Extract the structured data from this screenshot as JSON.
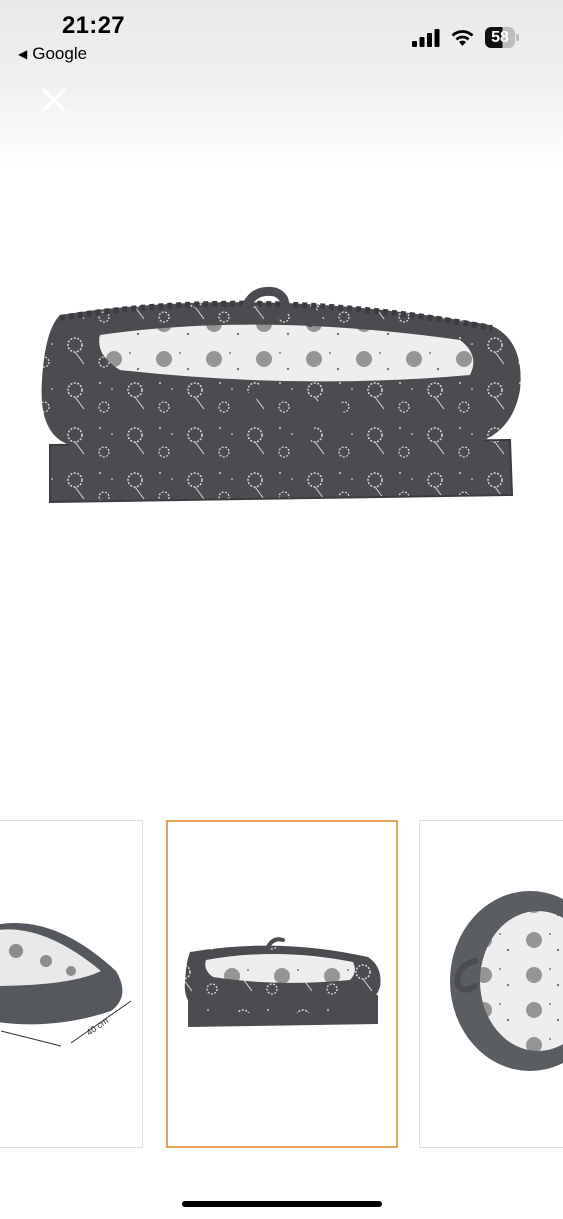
{
  "status_bar": {
    "time": "21:27",
    "back_app": "Google",
    "battery_level": "58"
  },
  "viewer": {
    "close_icon": "close-icon",
    "main_image": "product-image-baby-nest-dandelion",
    "thumbnails": [
      {
        "name": "thumbnail-1",
        "dimension_label": "40 cm",
        "selected": false
      },
      {
        "name": "thumbnail-2",
        "selected": true
      },
      {
        "name": "thumbnail-3",
        "selected": false
      }
    ]
  },
  "colors": {
    "fabric_dark": "#4a4c50",
    "fabric_light": "#eeeeee",
    "selected_border": "#e8a45a"
  }
}
